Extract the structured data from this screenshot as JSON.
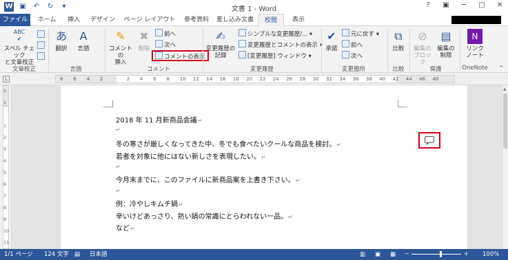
{
  "window": {
    "title": "文書 1 - Word",
    "controls": [
      "?",
      "▣",
      "─",
      "□",
      "✕"
    ]
  },
  "quick_access": [
    "save-icon",
    "undo-icon",
    "redo-icon",
    "touch-mode-icon"
  ],
  "tabs": [
    {
      "label": "ファイル"
    },
    {
      "label": "ホーム"
    },
    {
      "label": "挿入"
    },
    {
      "label": "デザイン"
    },
    {
      "label": "ページ レイアウト"
    },
    {
      "label": "参考資料"
    },
    {
      "label": "差し込み文書"
    },
    {
      "label": "校閲"
    },
    {
      "label": "表示"
    }
  ],
  "ribbon": {
    "proofing": {
      "label": "文章校正",
      "spell_label_1": "スペル チェック",
      "spell_label_2": "と文章校正",
      "abc_small": "ABC"
    },
    "language": {
      "label": "言語",
      "translate": "翻訳",
      "language": "言語"
    },
    "comments": {
      "label": "コメント",
      "new_comment_1": "コメントの",
      "new_comment_2": "挿入",
      "delete": "削除",
      "previous": "前へ",
      "next": "次へ",
      "show_comments": "コメントの表示"
    },
    "tracking": {
      "label": "変更履歴",
      "track_changes_1": "変更履歴の",
      "track_changes_2": "記録",
      "markup_view": "シンプルな変更履歴/...",
      "show_markup": "変更履歴とコメントの表示",
      "reviewing_pane": "[変更履歴] ウィンドウ"
    },
    "changes": {
      "label": "変更箇所",
      "accept": "承諾",
      "reject": "元に戻す",
      "previous": "前へ",
      "next": "次へ"
    },
    "compare": {
      "label": "比較",
      "compare": "比較"
    },
    "protect": {
      "label": "保護",
      "block_authors_1": "編集の",
      "block_authors_2": "ブロック",
      "restrict_editing_1": "編集の",
      "restrict_editing_2": "制限"
    },
    "onenote": {
      "label": "OneNote",
      "linked_notes_1": "リンク",
      "linked_notes_2": "ノート"
    }
  },
  "ruler": {
    "numbers": [
      "8",
      "6",
      "4",
      "2",
      "",
      "2",
      "4",
      "6",
      "8",
      "10",
      "12",
      "14",
      "16",
      "18",
      "20",
      "22",
      "24",
      "26",
      "28",
      "30",
      "32",
      "34",
      "36",
      "38",
      "40",
      "42",
      "44",
      "46",
      "48"
    ],
    "tab_selector": "L",
    "vertical_numbers": [
      "2",
      "1",
      "",
      "1",
      "2",
      "3",
      "4",
      "5",
      "6",
      "7",
      "8",
      "9",
      "10",
      "11"
    ]
  },
  "document": {
    "lines": [
      "2018 年 11 月新商品会議",
      "",
      "冬の寒さが厳しくなってきた中、冬でも食べたいクールな商品を検討。",
      "若者を対象に他にはない新しさを表現したい。",
      "",
      "今月末までに、このファイルに新商品案を上書き下さい。",
      "",
      "例：冷やしキムチ鍋",
      "辛いけどあっさり、熱い鍋の常識にとらわれない一品。",
      "など"
    ],
    "para_mark": "↵"
  },
  "status": {
    "page": "1/1 ページ",
    "words": "124 文字",
    "language": "日本語",
    "zoom": "100%",
    "zoom_minus": "－",
    "zoom_plus": "＋"
  },
  "colors": {
    "accent": "#2b579a",
    "highlight_box": "#d0021b"
  }
}
